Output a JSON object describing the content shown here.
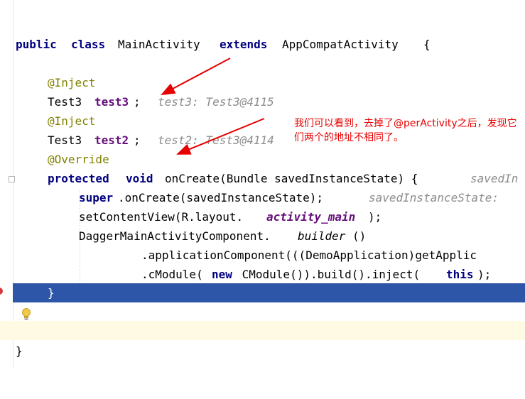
{
  "editor": {
    "line_class": [
      "public",
      "class",
      "MainActivity",
      "extends",
      "AppCompatActivity",
      "{"
    ],
    "line_inject1": {
      "annotation": "@Inject"
    },
    "line_field3": {
      "type": "Test3",
      "name": "test3",
      "semi": ";",
      "hint": "test3: Test3@4115"
    },
    "line_inject2": {
      "annotation": "@Inject"
    },
    "line_field2": {
      "type": "Test3",
      "name": "test2",
      "semi": ";",
      "hint": "test2: Test3@4114"
    },
    "line_override": {
      "annotation": "@Override"
    },
    "line_oncreate": {
      "kw1": "protected",
      "kw2": "void",
      "rest": "onCreate(Bundle savedInstanceState) {",
      "hint": "savedIn"
    },
    "line_super": {
      "kw": "super",
      "rest": ".onCreate(savedInstanceState);",
      "hint": "savedInstanceState:"
    },
    "line_setcontent": {
      "pre": "setContentView(R.layout.",
      "field": "activity_main",
      "post": ");"
    },
    "line_dagger": {
      "pre": "DaggerMainActivityComponent.",
      "method": "builder",
      "post": "()"
    },
    "line_appcomp": {
      "text": ".applicationComponent(((DemoApplication)getApplic"
    },
    "line_cmodule": {
      "p1": ".cModule(",
      "kw_new": "new",
      "p2": " CModule()).build().inject(",
      "kw_this": "this",
      "p3": ");"
    },
    "line_close_method": {
      "text": "}"
    },
    "line_close_class": {
      "text": "}"
    }
  },
  "annotation_note": {
    "text": "我们可以看到，去掉了@perActivity之后，发现它们两个的地址不相同了。",
    "color": "#e60000"
  },
  "colors": {
    "keyword": "#000080",
    "annotation": "#808000",
    "field": "#660e7a",
    "hint": "#8c8c8c",
    "selected_line": "#2d56a8",
    "caret_line": "#fffae3",
    "arrow": "#e60000"
  },
  "icons": [
    "lightbulb-icon",
    "fold-marker-icon",
    "breakpoint-marker"
  ]
}
